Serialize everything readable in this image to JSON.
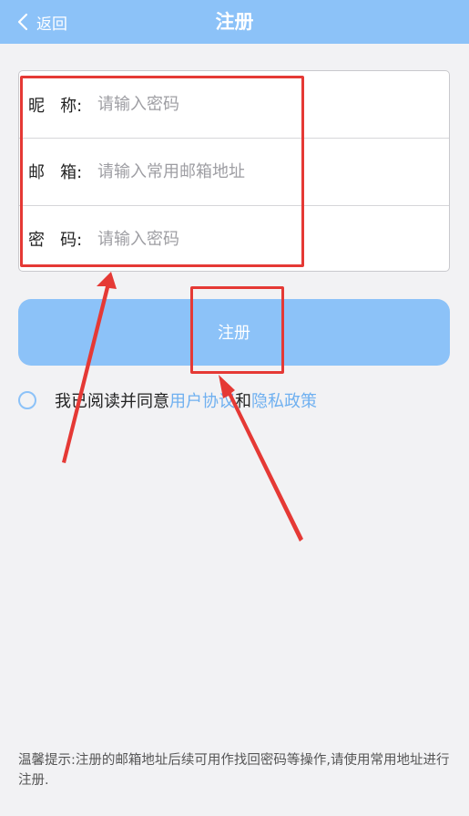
{
  "header": {
    "back_label": "返回",
    "title": "注册"
  },
  "form": {
    "nickname": {
      "label": "昵   称:",
      "placeholder": "请输入密码"
    },
    "email": {
      "label": "邮   箱:",
      "placeholder": "请输入常用邮箱地址"
    },
    "password": {
      "label": "密   码:",
      "placeholder": "请输入密码"
    }
  },
  "register_button": "注册",
  "agreement": {
    "prefix": "我已阅读并同意",
    "user_agreement": "用户协议",
    "conjunction": "和",
    "privacy_policy": "隐私政策"
  },
  "tip": "温馨提示:注册的邮箱地址后续可用作找回密码等操作,请使用常用地址进行注册.",
  "colors": {
    "header_bg": "#8cc2f8",
    "link": "#6fb0f0",
    "annotation": "#e53935"
  }
}
